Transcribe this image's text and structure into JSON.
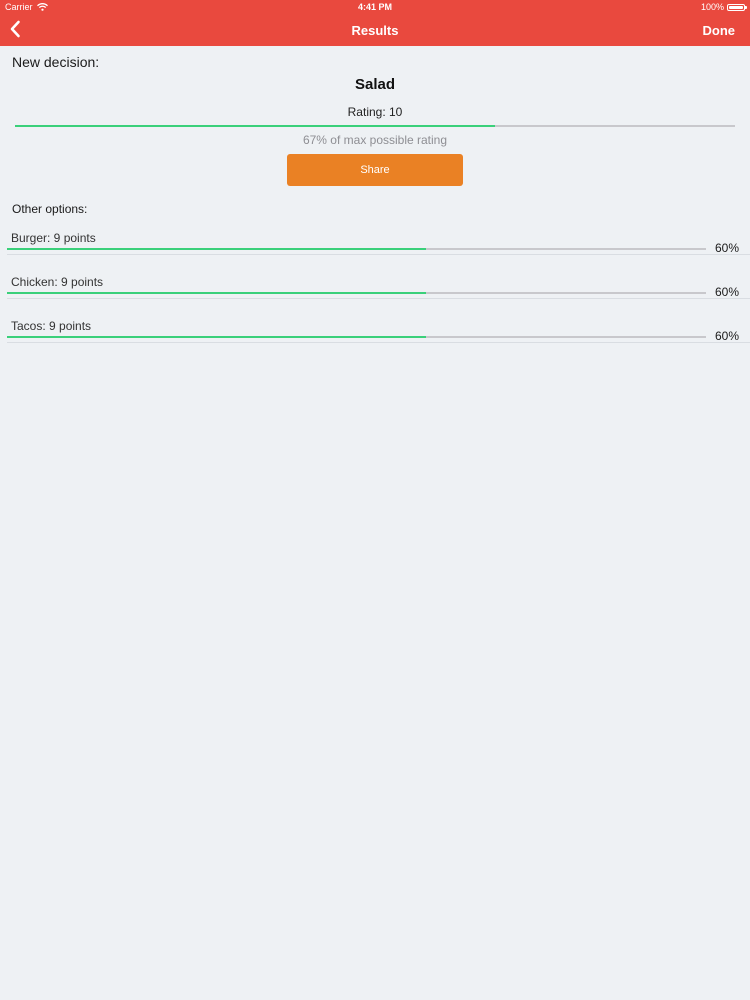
{
  "status_bar": {
    "carrier": "Carrier",
    "time": "4:41 PM",
    "battery": "100%"
  },
  "nav": {
    "back_icon": "chevron-left-icon",
    "title": "Results",
    "done_label": "Done"
  },
  "colors": {
    "nav_bar": "#e9493e",
    "share_button": "#ea8124",
    "progress_fill": "#3ad07a",
    "progress_track": "#c8c8cc",
    "background": "#eef1f4"
  },
  "decision": {
    "heading": "New decision:",
    "winner": "Salad",
    "rating": "Rating: 10",
    "progress_fraction": 0.667,
    "caption": "67% of max possible rating",
    "share_label": "Share"
  },
  "others": {
    "heading": "Other options:",
    "items": [
      {
        "label": "Burger: 9 points",
        "percent": "60%",
        "fraction": 0.6
      },
      {
        "label": "Chicken: 9 points",
        "percent": "60%",
        "fraction": 0.6
      },
      {
        "label": "Tacos: 9 points",
        "percent": "60%",
        "fraction": 0.6
      }
    ]
  }
}
